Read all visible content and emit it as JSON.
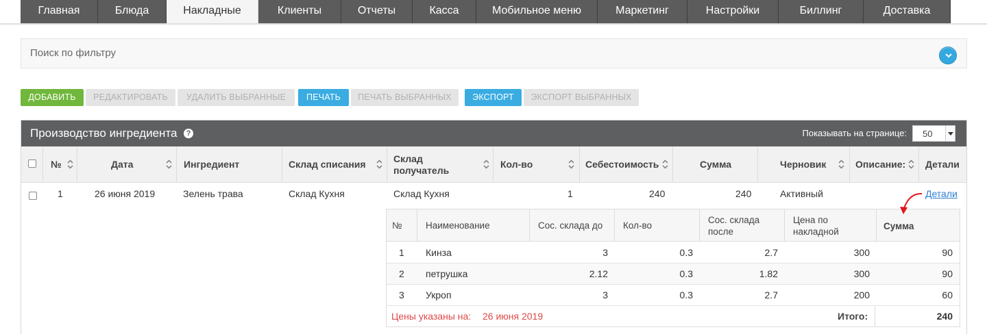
{
  "nav": {
    "tabs": [
      {
        "label": "Главная"
      },
      {
        "label": "Блюда"
      },
      {
        "label": "Накладные",
        "active": true
      },
      {
        "label": "Клиенты"
      },
      {
        "label": "Отчеты"
      },
      {
        "label": "Касса"
      },
      {
        "label": "Мобильное меню"
      },
      {
        "label": "Маркетинг"
      },
      {
        "label": "Настройки"
      },
      {
        "label": "Биллинг"
      },
      {
        "label": "Доставка"
      }
    ]
  },
  "filter": {
    "label": "Поиск по фильтру"
  },
  "toolbar": {
    "add": "Добавить",
    "edit": "Редактировать",
    "delete_selected": "Удалить выбранные",
    "print": "Печать",
    "print_selected": "Печать выбранных",
    "export": "Экспорт",
    "export_selected": "Экспорт выбранных"
  },
  "panel": {
    "title": "Производство ингредиента",
    "help": "?",
    "per_page_label": "Показывать на странице:",
    "per_page_value": "50"
  },
  "table": {
    "headers": {
      "num": "№",
      "date": "Дата",
      "ingredient": "Ингредиент",
      "warehouse_from": "Склад списания",
      "warehouse_to_1": "Склад",
      "warehouse_to_2": "получатель",
      "qty": "Кол-во",
      "cost": "Себестоимость",
      "sum": "Сумма",
      "draft": "Черновик",
      "description": "Описание:",
      "details": "Детали"
    },
    "row": {
      "num": "1",
      "date": "26 июня 2019",
      "ingredient": "Зелень трава",
      "warehouse_from": "Склад Кухня",
      "warehouse_to": "Склад Кухня",
      "qty": "1",
      "cost": "240",
      "sum": "240",
      "draft": "Активный",
      "details": "Детали"
    }
  },
  "subtable": {
    "headers": {
      "num": "№",
      "name": "Наименование",
      "stock_before": "Сос. склада до",
      "qty": "Кол-во",
      "stock_after_1": "Сос. склада",
      "stock_after_2": "после",
      "price_1": "Цена по",
      "price_2": "накладной",
      "sum": "Сумма"
    },
    "rows": [
      {
        "num": "1",
        "name": "Кинза",
        "stock_before": "3",
        "qty": "0.3",
        "stock_after": "2.7",
        "price": "300",
        "sum": "90"
      },
      {
        "num": "2",
        "name": "петрушка",
        "stock_before": "2.12",
        "qty": "0.3",
        "stock_after": "1.82",
        "price": "300",
        "sum": "90"
      },
      {
        "num": "3",
        "name": "Укроп",
        "stock_before": "3",
        "qty": "0.3",
        "stock_after": "2.7",
        "price": "200",
        "sum": "60"
      }
    ],
    "footer": {
      "note": "Цены указаны на:",
      "date": "26 июня 2019",
      "total_label": "Итого:",
      "total": "240"
    }
  },
  "colors": {
    "accent_blue": "#3aace1",
    "accent_green": "#71b73c",
    "header_dark": "#5e5f61",
    "note_red": "#e04848"
  }
}
